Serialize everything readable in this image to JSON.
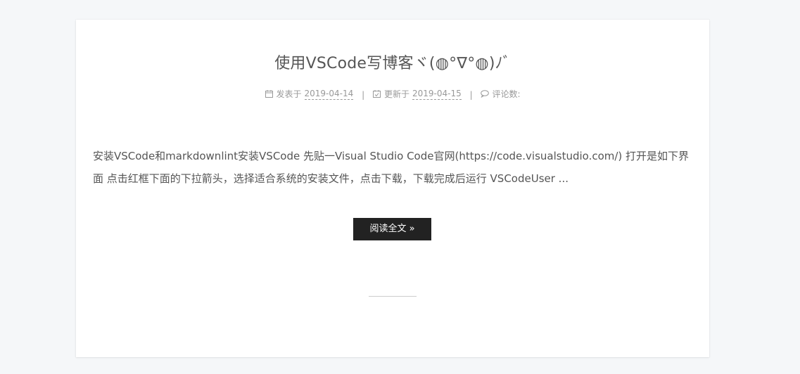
{
  "post": {
    "title": "使用VSCode写博客ヾ(◍°∇°◍)ﾉﾞ",
    "meta": {
      "posted_label": "发表于",
      "posted_date": "2019-04-14",
      "updated_label": "更新于",
      "updated_date": "2019-04-15",
      "comments_label": "评论数:",
      "divider": "|"
    },
    "excerpt": "安装VSCode和markdownlint安装VSCode 先贴一Visual Studio Code官网(https://code.visualstudio.com/) 打开是如下界面 点击红框下面的下拉箭头，选择适合系统的安装文件，点击下载，下载完成后运行 VSCodeUser ...",
    "read_more_label": "阅读全文 »"
  },
  "icons": {
    "posted": "calendar-icon",
    "updated": "calendar-check-icon",
    "comments": "comment-icon"
  },
  "colors": {
    "button_bg": "#222222",
    "text": "#555555",
    "meta": "#999999"
  }
}
